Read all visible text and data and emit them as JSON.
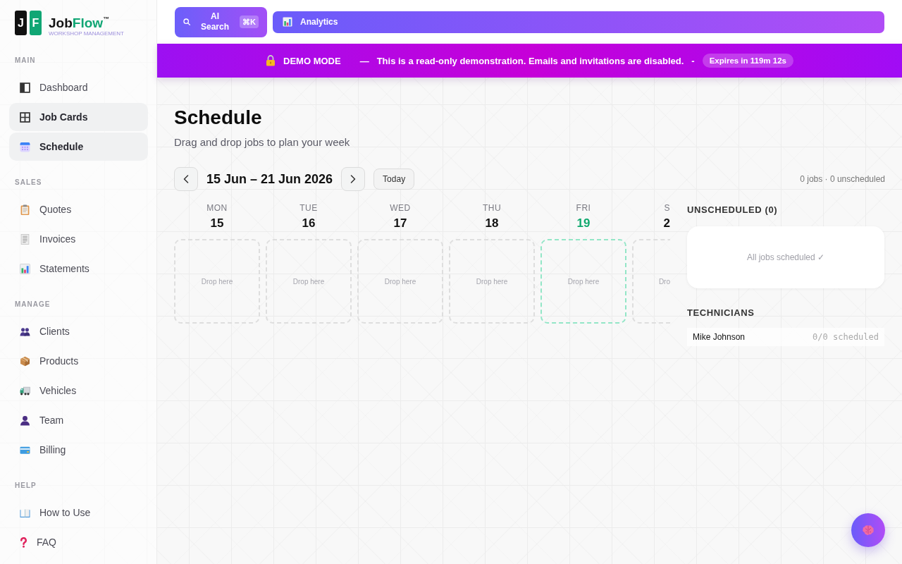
{
  "sidebar": {
    "logo": {
      "tiles": [
        "J",
        "F"
      ],
      "wordmark": [
        "Job",
        "Flow"
      ],
      "trademark": "™",
      "tagline": "WORKSHOP MANAGEMENT"
    },
    "sections": [
      {
        "title": "MAIN",
        "items": [
          {
            "label": "Dashboard",
            "selected": false
          },
          {
            "label": "Job Cards",
            "selected": true
          },
          {
            "label": "Schedule",
            "selected": true
          }
        ]
      },
      {
        "title": "SALES",
        "items": [
          {
            "label": "Quotes",
            "selected": false
          },
          {
            "label": "Invoices",
            "selected": false
          },
          {
            "label": "Statements",
            "selected": false
          }
        ]
      },
      {
        "title": "MANAGE",
        "items": [
          {
            "label": "Clients",
            "selected": false
          },
          {
            "label": "Products",
            "selected": false
          },
          {
            "label": "Vehicles",
            "selected": false
          },
          {
            "label": "Team",
            "selected": false
          },
          {
            "label": "Billing",
            "selected": false
          }
        ]
      },
      {
        "title": "HELP",
        "items": [
          {
            "label": "How to Use",
            "selected": false
          },
          {
            "label": "FAQ",
            "selected": false
          }
        ]
      }
    ]
  },
  "topbar": {
    "ai_search": {
      "label": "AI Search",
      "shortcut": "⌘K"
    },
    "analytics": {
      "label": "Analytics"
    }
  },
  "demo_banner": {
    "title": "DEMO MODE",
    "separator": "—",
    "message": "This is a read-only demonstration. Emails and invitations are disabled.",
    "divider": "-",
    "expires": "Expires in 119m 12s"
  },
  "page": {
    "title": "Schedule",
    "subtitle": "Drag and drop jobs to plan your week"
  },
  "week_nav": {
    "range": "15 Jun – 21 Jun 2026",
    "today_button": "Today",
    "summary": "0 jobs · 0 unscheduled"
  },
  "days": [
    {
      "name": "MON",
      "date": "15",
      "drop_label": "Drop here",
      "today": false,
      "cut": false
    },
    {
      "name": "TUE",
      "date": "16",
      "drop_label": "Drop here",
      "today": false,
      "cut": false
    },
    {
      "name": "WED",
      "date": "17",
      "drop_label": "Drop here",
      "today": false,
      "cut": false
    },
    {
      "name": "THU",
      "date": "18",
      "drop_label": "Drop here",
      "today": false,
      "cut": false
    },
    {
      "name": "FRI",
      "date": "19",
      "drop_label": "Drop here",
      "today": true,
      "cut": false
    },
    {
      "name": "S",
      "date": "2",
      "drop_label": "Dro",
      "today": false,
      "cut": true
    }
  ],
  "unscheduled": {
    "title": "UNSCHEDULED (0)",
    "empty_text": "All jobs scheduled ✓"
  },
  "technicians": {
    "title": "TECHNICIANS",
    "rows": [
      {
        "name": "Mike Johnson",
        "count": "0/0 scheduled"
      }
    ]
  }
}
